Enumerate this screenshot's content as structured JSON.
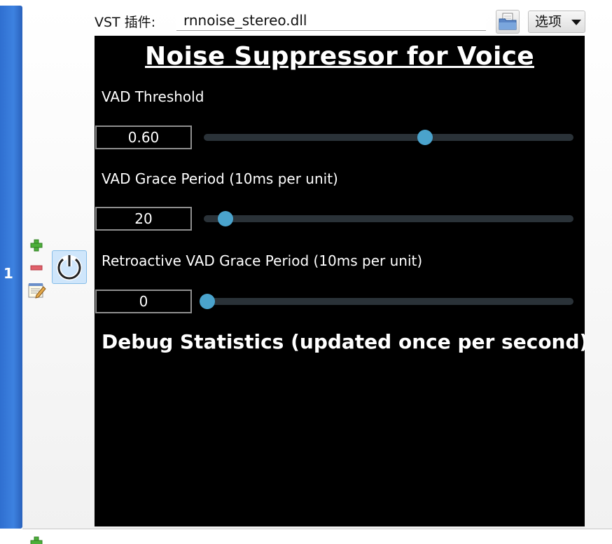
{
  "slot": {
    "index": "1",
    "vst_label": "VST 插件:",
    "dll_name": "rnnoise_stereo.dll",
    "options_label": "选项"
  },
  "plugin": {
    "title": "Noise Suppressor for Voice",
    "params": [
      {
        "label": "VAD Threshold",
        "value": "0.60",
        "level": 0.6
      },
      {
        "label": "VAD Grace Period (10ms per unit)",
        "value": "20",
        "level": 0.05
      },
      {
        "label": "Retroactive VAD Grace Period (10ms per unit)",
        "value": "0",
        "level": 0.0
      }
    ],
    "debug_heading": "Debug Statistics (updated once per second)"
  },
  "colors": {
    "index_blue": "#3d82e0",
    "slider_thumb": "#4aa3cc",
    "slider_track": "#2a3238",
    "plugin_bg": "#000000",
    "power_bg": "#cfe6fb"
  },
  "icons": {
    "folder": "open-folder-icon",
    "add": "plus-icon",
    "remove": "minus-icon",
    "edit": "notepad-edit-icon",
    "power": "power-icon",
    "dropdown": "chevron-down-icon"
  }
}
